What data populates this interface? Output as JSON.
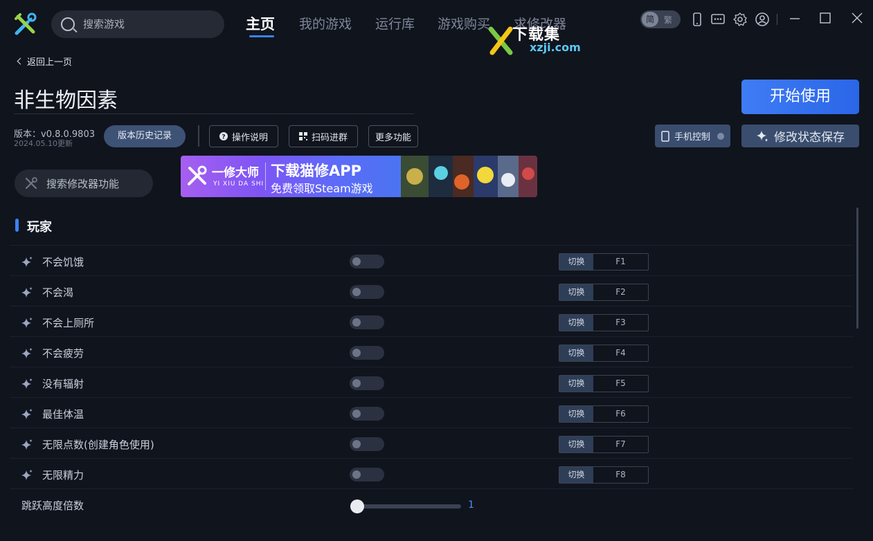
{
  "search": {
    "placeholder": "搜索游戏"
  },
  "nav": [
    {
      "label": "主页"
    },
    {
      "label": "我的游戏"
    },
    {
      "label": "运行库"
    },
    {
      "label": "游戏购买"
    },
    {
      "label": "求修改器"
    }
  ],
  "watermark": {
    "line1": "下载集",
    "line2": "xzji.com"
  },
  "lang": {
    "simplified": "简",
    "traditional": "繁"
  },
  "back_label": "返回上一页",
  "game_title": "非生物因素",
  "start_button": "开始使用",
  "version": {
    "text": "版本：v0.8.0.9803",
    "date": "2024.05.10更新"
  },
  "buttons": {
    "history": "版本历史记录",
    "manual": "操作说明",
    "qr_group": "扫码进群",
    "more": "更多功能",
    "phone_control": "手机控制",
    "save_state": "修改状态保存"
  },
  "feature_search": {
    "placeholder": "搜索修改器功能"
  },
  "banner": {
    "brand": "一修大师",
    "brand_sub": "YI XIU DA SHI",
    "title": "下载猫修APP",
    "subtitle": "免费领取Steam游戏"
  },
  "section_title": "玩家",
  "toggle_label": "切换",
  "features": [
    {
      "label": "不会饥饿",
      "key": "F1"
    },
    {
      "label": "不会渴",
      "key": "F2"
    },
    {
      "label": "不会上厕所",
      "key": "F3"
    },
    {
      "label": "不会疲劳",
      "key": "F4"
    },
    {
      "label": "没有辐射",
      "key": "F5"
    },
    {
      "label": "最佳体温",
      "key": "F6"
    },
    {
      "label": "无限点数(创建角色使用)",
      "key": "F7"
    },
    {
      "label": "无限精力",
      "key": "F8"
    }
  ],
  "slider": {
    "label": "跳跃高度倍数",
    "value": "1",
    "level": 0
  },
  "colors": {
    "accent": "#3b82f6",
    "background": "#10141d"
  }
}
